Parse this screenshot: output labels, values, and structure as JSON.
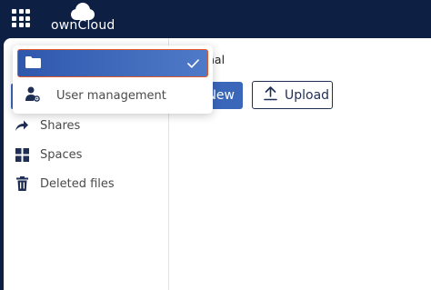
{
  "app": {
    "brand": "ownCloud"
  },
  "dropdown": {
    "items": [
      {
        "label": "",
        "icon": "folder-icon",
        "selected": true
      },
      {
        "label": "User management",
        "icon": "user-settings-icon",
        "selected": false
      }
    ]
  },
  "sidebar": {
    "items": [
      {
        "label": "Shares",
        "icon": "share-arrow-icon"
      },
      {
        "label": "Spaces",
        "icon": "grid-icon"
      },
      {
        "label": "Deleted files",
        "icon": "trash-icon"
      }
    ]
  },
  "main": {
    "breadcrumb_tail": "nal",
    "new_button_label": "New",
    "upload_button_label": "Upload"
  },
  "colors": {
    "topbar": "#0e1f44",
    "accent": "#3b67ba",
    "focus_border": "#e0582a"
  }
}
